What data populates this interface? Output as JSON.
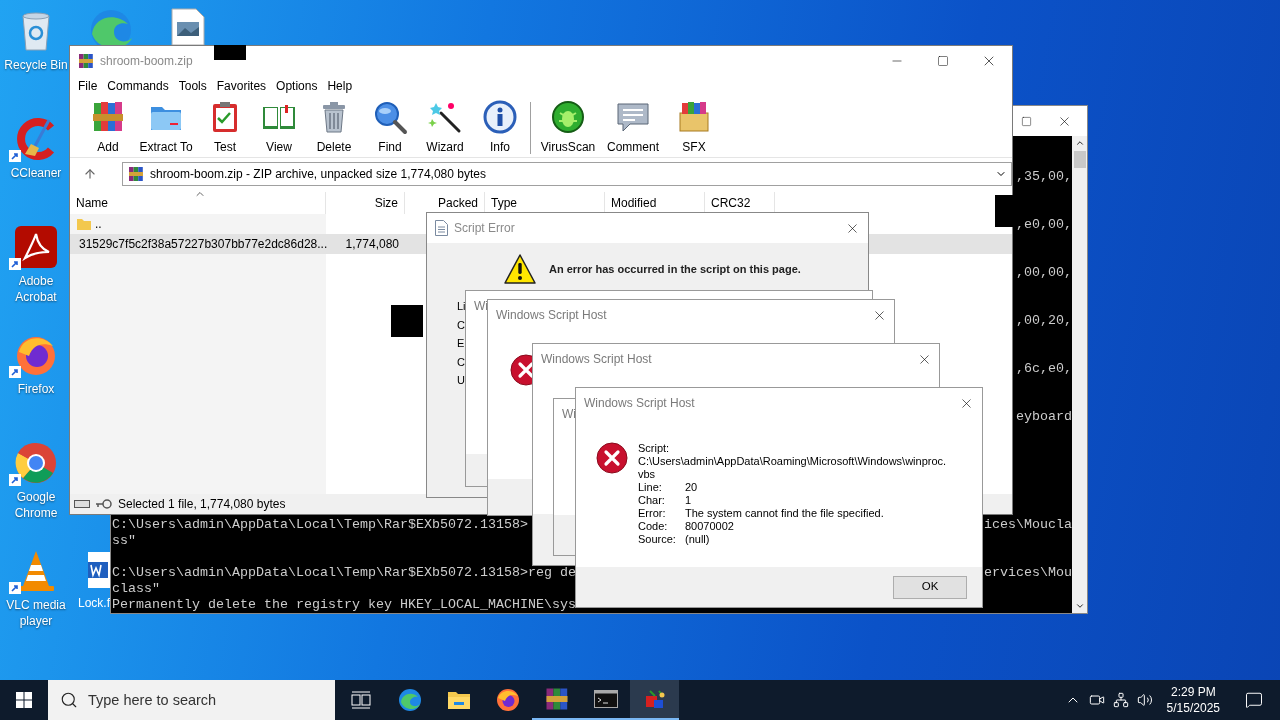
{
  "desktop_icons": [
    {
      "label": "Recycle Bin"
    },
    {
      "label": "CCleaner"
    },
    {
      "label": "Adobe Acrobat"
    },
    {
      "label": "Firefox"
    },
    {
      "label": "Google Chrome"
    },
    {
      "label": "VLC media player"
    }
  ],
  "desktop_file": {
    "label": "Lock.f"
  },
  "console": {
    "right_fragments": [
      ",35,00,",
      ",e0,00,",
      ",00,00,",
      ",00,20,",
      ",6c,e0,",
      "eyboard"
    ],
    "blocks": [
      [
        {
          "left": "C:\\Users\\admin\\AppData\\Local\\Temp\\Rar$EXb5072.13158>",
          "right": "ices\\Moucla"
        },
        {
          "left": "ss\""
        }
      ],
      [
        {
          "left": "C:\\Users\\admin\\AppData\\Local\\Temp\\Rar$EXb5072.13158>reg de",
          "right": "ervices\\Mou"
        },
        {
          "left": "class\""
        },
        {
          "left": "Permanently delete the registry key HKEY_LOCAL_MACHINE\\sys"
        }
      ]
    ]
  },
  "winrar": {
    "title": "shroom-boom.zip",
    "menu": [
      "File",
      "Commands",
      "Tools",
      "Favorites",
      "Options",
      "Help"
    ],
    "tools": [
      "Add",
      "Extract To",
      "Test",
      "View",
      "Delete",
      "Find",
      "Wizard",
      "Info",
      "VirusScan",
      "Comment",
      "SFX"
    ],
    "address": "shroom-boom.zip - ZIP archive, unpacked size 1,774,080 bytes",
    "columns": [
      "Name",
      "Size",
      "Packed",
      "Type",
      "Modified",
      "CRC32"
    ],
    "rows": [
      {
        "kind": "folder",
        "name": "..",
        "selected": false
      },
      {
        "kind": "file",
        "name": "31529c7f5c2f38a57227b307bb77e2dc86d28...",
        "size": "1,774,080",
        "selected": true
      }
    ],
    "status": "Selected 1 file, 1,774,080 bytes"
  },
  "script_error": {
    "title": "Script Error",
    "message": "An error has occurred in the script on this page.",
    "labels": [
      "Li",
      "C",
      "E",
      "C",
      "U"
    ]
  },
  "wsh_stack": [
    {
      "title": "Wi"
    },
    {
      "title": "Windows Script Host"
    },
    {
      "title": "Windows Script Host"
    },
    {
      "title": "Wi"
    }
  ],
  "wsh": {
    "title": "Windows Script Host",
    "script_label": "Script:",
    "script_path": "C:\\Users\\admin\\AppData\\Roaming\\Microsoft\\Windows\\winproc.vbs",
    "fields": [
      {
        "label": "Line:",
        "value": "20"
      },
      {
        "label": "Char:",
        "value": "1"
      },
      {
        "label": "Error:",
        "value": "The system cannot find the file specified."
      },
      {
        "label": "Code:",
        "value": "80070002"
      },
      {
        "label": "Source:",
        "value": "(null)"
      }
    ],
    "button": "OK"
  },
  "taskbar": {
    "search_placeholder": "Type here to search",
    "apps": [
      {
        "running": false,
        "selected": false
      },
      {
        "running": false,
        "selected": false
      },
      {
        "running": false,
        "selected": false
      },
      {
        "running": false,
        "selected": false
      },
      {
        "running": true,
        "selected": false
      },
      {
        "running": true,
        "selected": false
      },
      {
        "running": true,
        "selected": true
      }
    ],
    "time": "2:29 PM",
    "date": "5/15/2025"
  }
}
